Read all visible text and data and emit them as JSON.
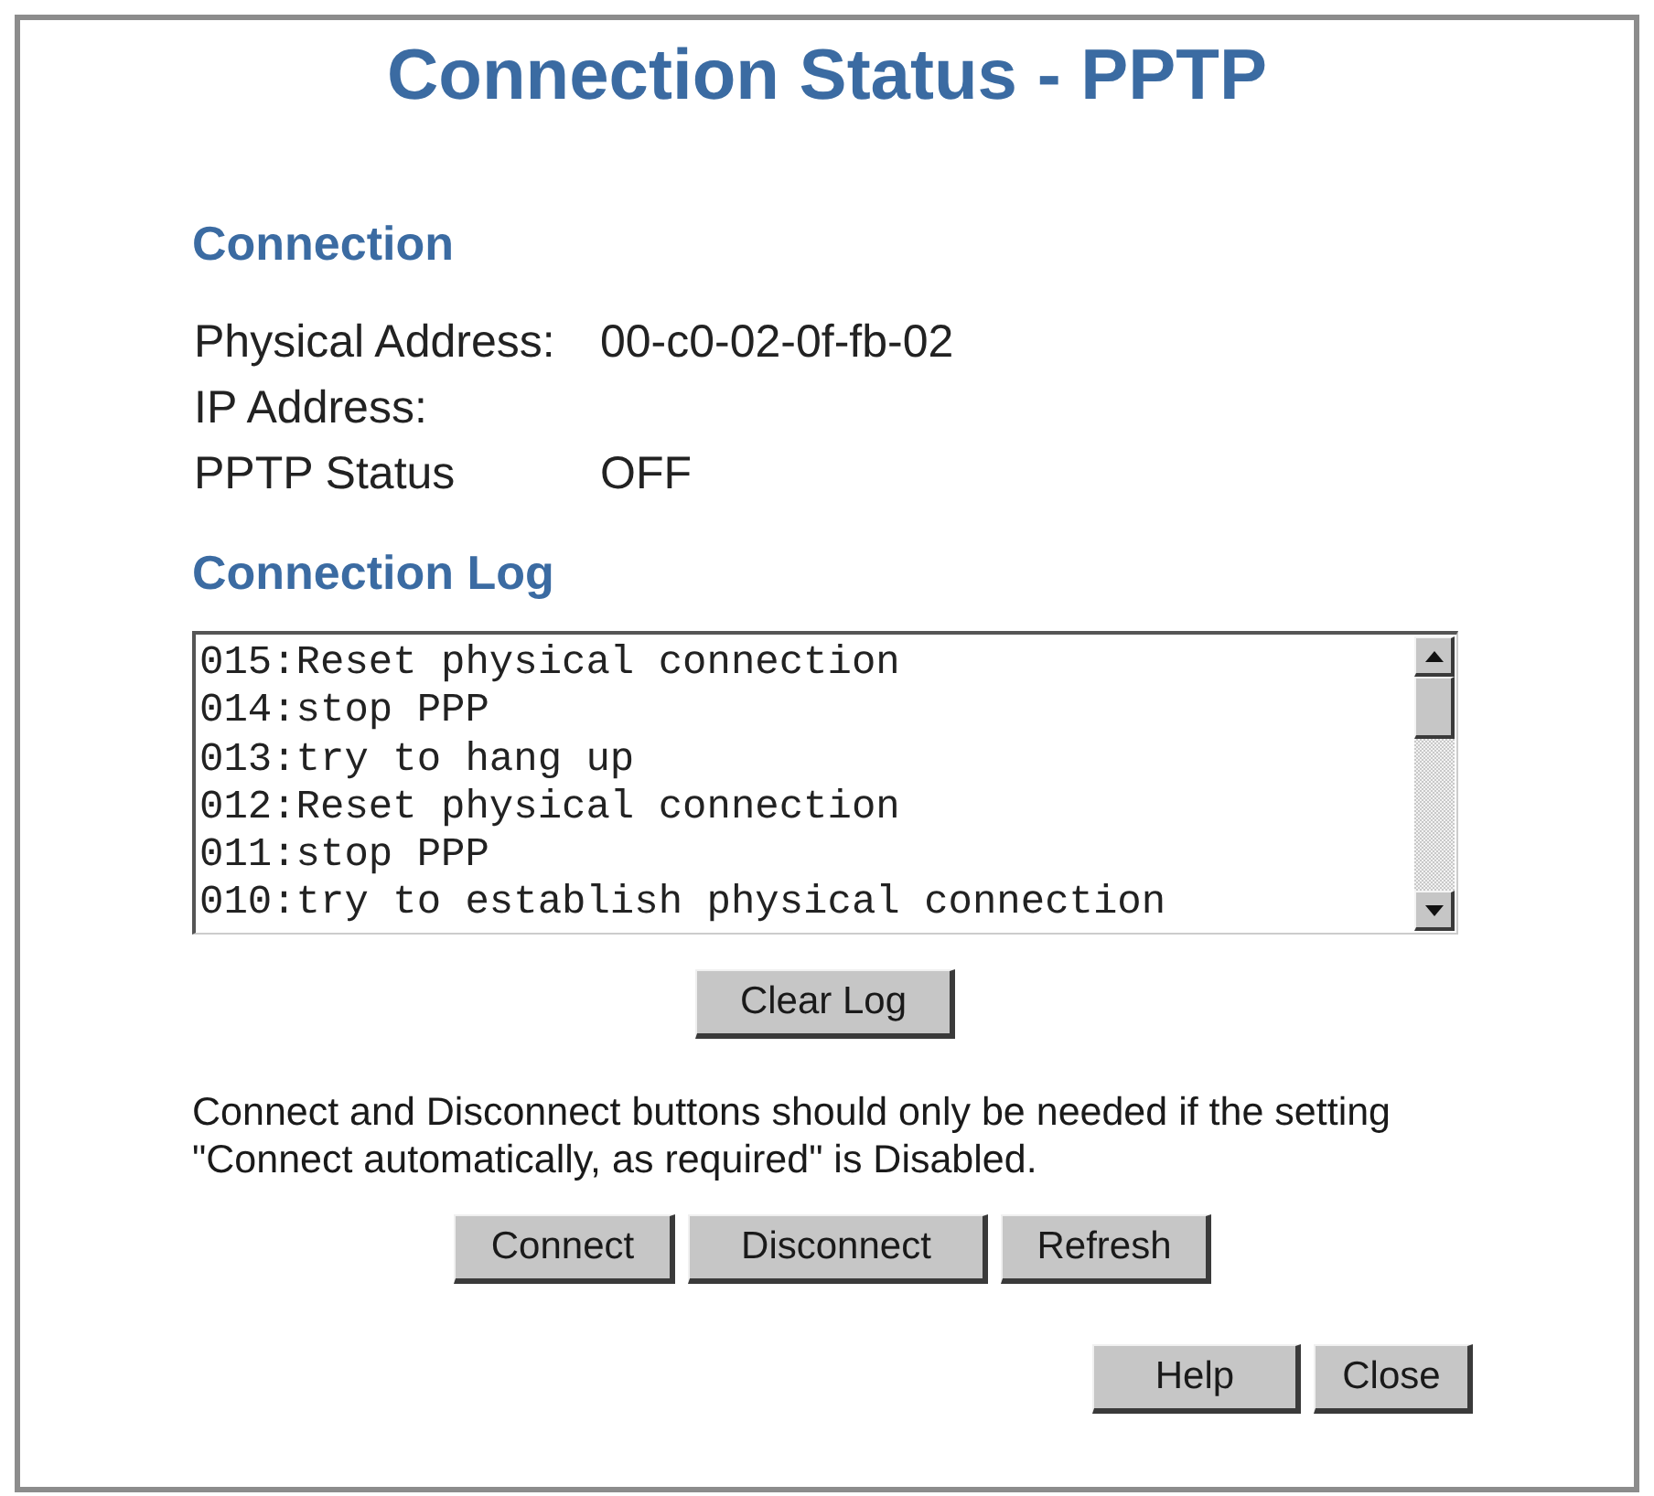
{
  "window": {
    "title": "Connection Status - PPTP"
  },
  "connection": {
    "heading": "Connection",
    "fields": [
      {
        "label": "Physical Address:",
        "value": "00-c0-02-0f-fb-02"
      },
      {
        "label": "IP Address:"
      },
      {
        "label": "PPTP Status",
        "value": "OFF"
      }
    ]
  },
  "connection_log": {
    "heading": "Connection Log",
    "entries": [
      "015:Reset physical connection",
      "014:stop PPP",
      "013:try to hang up",
      "012:Reset physical connection",
      "011:stop PPP",
      "010:try to establish physical connection"
    ],
    "button": "Clear Log"
  },
  "note": "Connect and Disconnect buttons should only be needed if the setting \"Connect automatically, as required\" is Disabled.",
  "actions": [
    "Connect",
    "Disconnect",
    "Refresh"
  ],
  "footer_buttons": [
    "Help",
    "Close"
  ]
}
